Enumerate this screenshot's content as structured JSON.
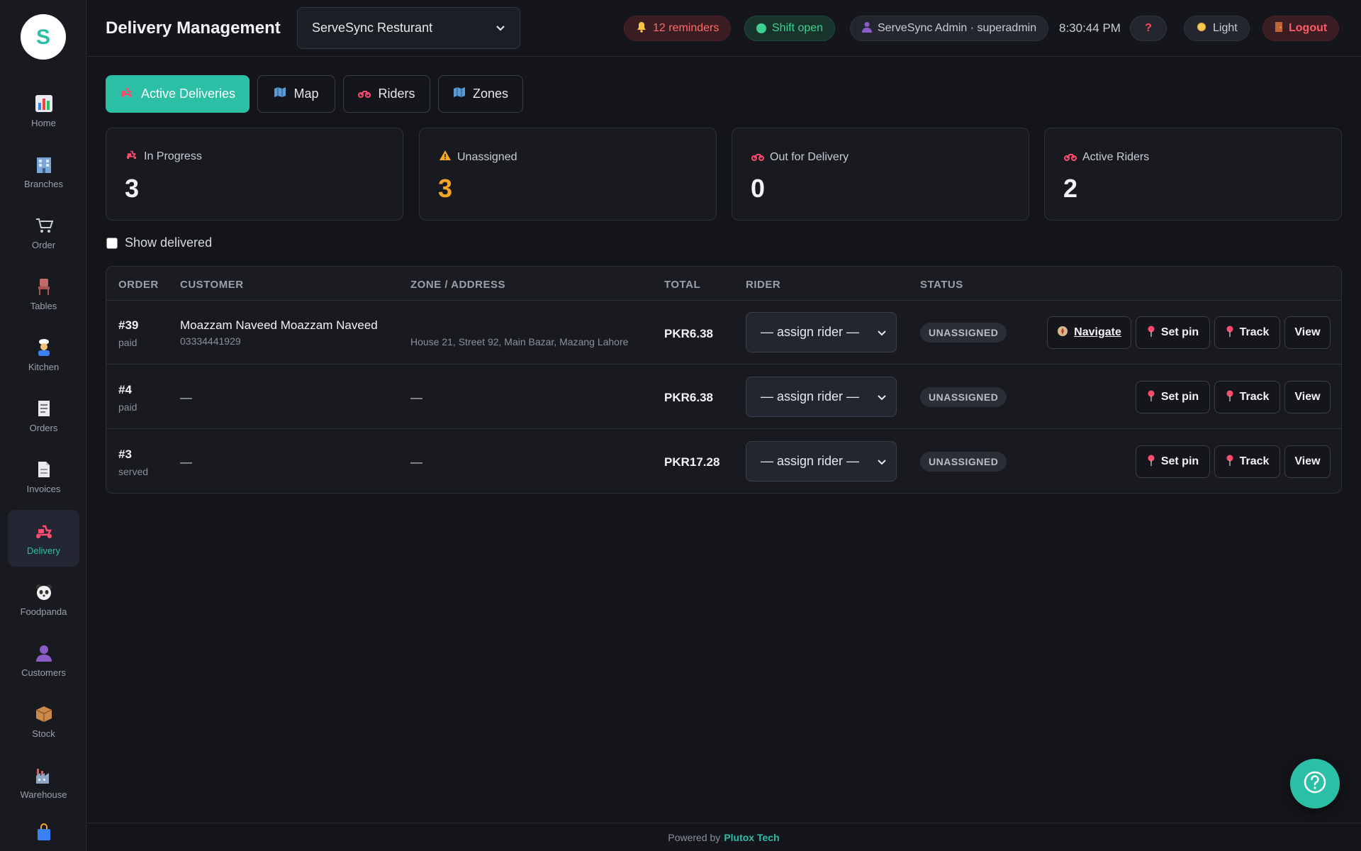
{
  "sidebar": {
    "logo_letter": "S",
    "items": [
      {
        "label": "Home",
        "icon": "chart-icon"
      },
      {
        "label": "Branches",
        "icon": "building-icon"
      },
      {
        "label": "Order",
        "icon": "cart-icon"
      },
      {
        "label": "Tables",
        "icon": "chair-icon"
      },
      {
        "label": "Kitchen",
        "icon": "chef-icon"
      },
      {
        "label": "Orders",
        "icon": "receipt-icon"
      },
      {
        "label": "Invoices",
        "icon": "document-icon"
      },
      {
        "label": "Delivery",
        "icon": "scooter-icon",
        "active": true
      },
      {
        "label": "Foodpanda",
        "icon": "panda-icon"
      },
      {
        "label": "Customers",
        "icon": "user-icon"
      },
      {
        "label": "Stock",
        "icon": "box-icon"
      },
      {
        "label": "Warehouse",
        "icon": "factory-icon"
      }
    ]
  },
  "header": {
    "title": "Delivery Management",
    "branch": "ServeSync Resturant",
    "reminders": "12 reminders",
    "shift": "Shift open",
    "user": "ServeSync Admin · superadmin",
    "time": "8:30:44 PM",
    "help": "?",
    "theme": "Light",
    "logout": "Logout"
  },
  "tabs": [
    {
      "label": "Active Deliveries",
      "active": true
    },
    {
      "label": "Map"
    },
    {
      "label": "Riders"
    },
    {
      "label": "Zones"
    }
  ],
  "stats": [
    {
      "label": "In Progress",
      "value": "3"
    },
    {
      "label": "Unassigned",
      "value": "3"
    },
    {
      "label": "Out for Delivery",
      "value": "0"
    },
    {
      "label": "Active Riders",
      "value": "2"
    }
  ],
  "show_delivered_label": "Show delivered",
  "table": {
    "headers": [
      "ORDER",
      "CUSTOMER",
      "ZONE / ADDRESS",
      "TOTAL",
      "RIDER",
      "STATUS"
    ],
    "rows": [
      {
        "order": "#39",
        "payment": "paid",
        "customer": "Moazzam Naveed Moazzam Naveed",
        "phone": "03334441929",
        "address": "House 21, Street 92, Main Bazar, Mazang Lahore",
        "total": "PKR6.38",
        "rider": "— assign rider —",
        "status": "UNASSIGNED",
        "navigate": "Navigate"
      },
      {
        "order": "#4",
        "payment": "paid",
        "customer": "—",
        "phone": "",
        "address": "—",
        "total": "PKR6.38",
        "rider": "— assign rider —",
        "status": "UNASSIGNED"
      },
      {
        "order": "#3",
        "payment": "served",
        "customer": "—",
        "phone": "",
        "address": "—",
        "total": "PKR17.28",
        "rider": "— assign rider —",
        "status": "UNASSIGNED"
      }
    ],
    "actions": {
      "set_pin": "Set pin",
      "track": "Track",
      "view": "View"
    }
  },
  "footer": {
    "prefix": "Powered by",
    "brand": "Plutox Tech"
  },
  "colors": {
    "accent": "#2bbfa6",
    "danger": "#ff5a67",
    "warning": "#f6a623",
    "success": "#3fd08f"
  }
}
